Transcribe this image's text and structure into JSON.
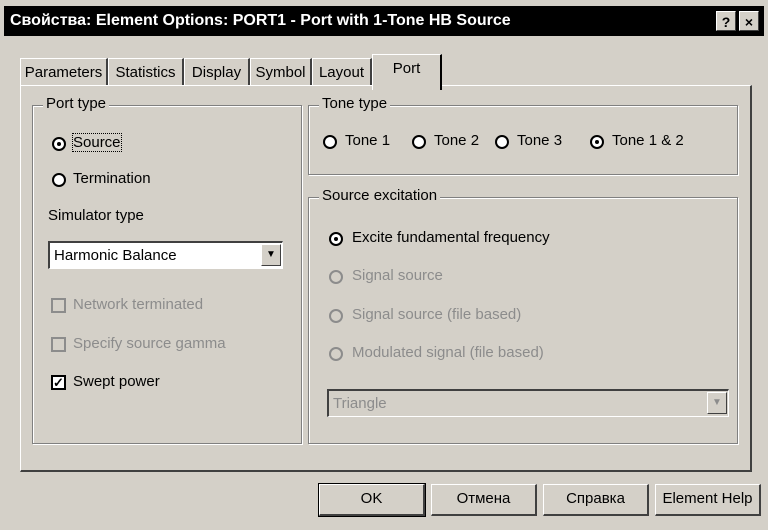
{
  "window": {
    "title": "Свойства: Element Options: PORT1 - Port with 1-Tone HB Source",
    "help_btn": "?",
    "close_btn": "×"
  },
  "tabs": [
    {
      "label": "Parameters",
      "active": false
    },
    {
      "label": "Statistics",
      "active": false
    },
    {
      "label": "Display",
      "active": false
    },
    {
      "label": "Symbol",
      "active": false
    },
    {
      "label": "Layout",
      "active": false
    },
    {
      "label": "Port",
      "active": true
    }
  ],
  "port_type": {
    "legend": "Port type",
    "options": [
      {
        "label": "Source",
        "selected": true
      },
      {
        "label": "Termination",
        "selected": false
      }
    ],
    "simulator_label": "Simulator type",
    "simulator_value": "Harmonic Balance",
    "checks": [
      {
        "label": "Network terminated",
        "checked": false,
        "enabled": false
      },
      {
        "label": "Specify source gamma",
        "checked": false,
        "enabled": false
      },
      {
        "label": "Swept power",
        "checked": true,
        "enabled": true
      }
    ]
  },
  "tone_type": {
    "legend": "Tone type",
    "options": [
      {
        "label": "Tone 1",
        "selected": false
      },
      {
        "label": "Tone 2",
        "selected": false
      },
      {
        "label": "Tone 3",
        "selected": false
      },
      {
        "label": "Tone 1 & 2",
        "selected": true
      }
    ]
  },
  "source_excitation": {
    "legend": "Source excitation",
    "options": [
      {
        "label": "Excite fundamental frequency",
        "selected": true,
        "enabled": true
      },
      {
        "label": "Signal source",
        "selected": false,
        "enabled": false
      },
      {
        "label": "Signal source (file based)",
        "selected": false,
        "enabled": false
      },
      {
        "label": "Modulated signal (file based)",
        "selected": false,
        "enabled": false
      }
    ],
    "waveform_value": "Triangle"
  },
  "buttons": {
    "ok": "OK",
    "cancel": "Отмена",
    "help": "Справка",
    "element_help": "Element Help"
  },
  "check_mark": "✓",
  "combo_arrow": "▼"
}
